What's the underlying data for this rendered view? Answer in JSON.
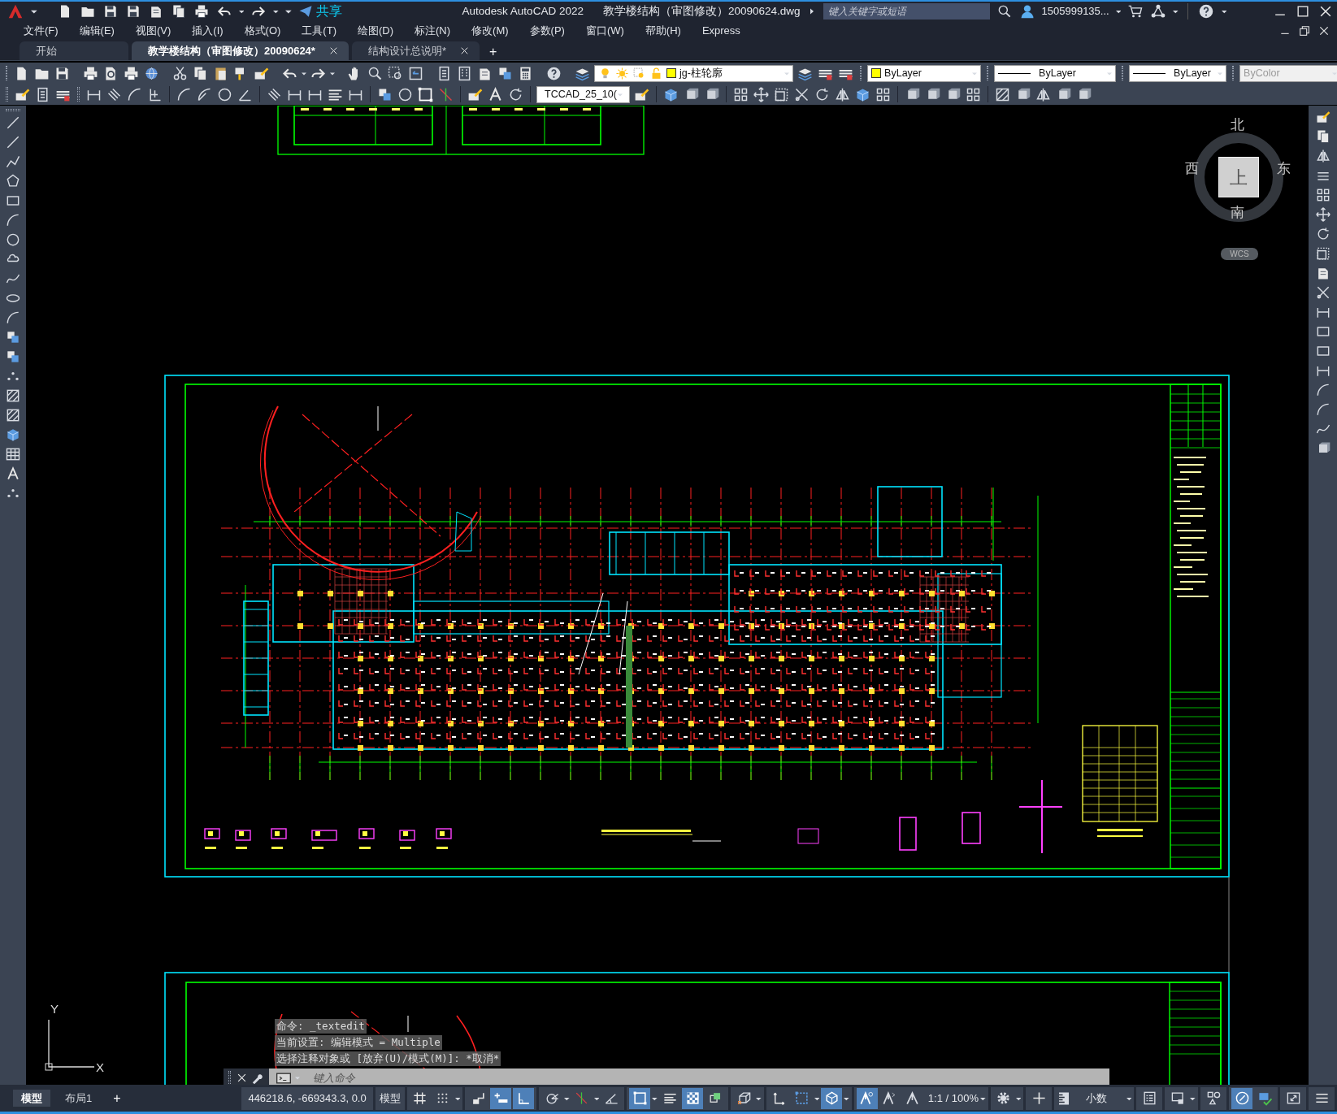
{
  "title_bar": {
    "app": "Autodesk AutoCAD 2022",
    "document": "教学楼结构（审图修改）20090624.dwg",
    "share": "共享",
    "search": {
      "placeholder": "键入关键字或短语"
    },
    "user": "1505999135..."
  },
  "menus": [
    "文件(F)",
    "编辑(E)",
    "视图(V)",
    "插入(I)",
    "格式(O)",
    "工具(T)",
    "绘图(D)",
    "标注(N)",
    "修改(M)",
    "参数(P)",
    "窗口(W)",
    "帮助(H)",
    "Express"
  ],
  "tabs": [
    {
      "label": "开始",
      "selected": false,
      "closable": false
    },
    {
      "label": "教学楼结构（审图修改）20090624*",
      "selected": true,
      "closable": true
    },
    {
      "label": "结构设计总说明*",
      "selected": false,
      "closable": true
    }
  ],
  "new_tab": "+",
  "properties": {
    "layer": {
      "name": "jg-柱轮廓",
      "color": "#ffff00"
    },
    "color": {
      "value": "ByLayer",
      "color": "#ffff00"
    },
    "linetype": "ByLayer",
    "lineweight": "ByLayer",
    "plot_style": {
      "value": "ByColor",
      "disabled": true
    }
  },
  "text_style": "TCCAD_25_10(",
  "viewcube": {
    "north": "北",
    "south": "南",
    "west": "西",
    "east": "东",
    "face": "上",
    "ucs": "WCS"
  },
  "ucs_icon": {
    "x": "X",
    "y": "Y"
  },
  "command_line": {
    "history": [
      "命令: _textedit",
      "当前设置: 编辑模式 = Multiple",
      "选择注释对象或 [放弃(U)/模式(M)]: *取消*"
    ],
    "placeholder": "键入命令"
  },
  "layout_tabs": [
    {
      "label": "模型",
      "selected": true
    },
    {
      "label": "布局1",
      "selected": false
    }
  ],
  "new_layout": "+",
  "status_bar": {
    "coordinates": "446218.6, -669343.3, 0.0",
    "space": "模型",
    "toggles": [
      {
        "on": false
      },
      {
        "on": false
      },
      {
        "on": false
      },
      {
        "on": true
      },
      {
        "on": true
      },
      {
        "on": false
      },
      {
        "on": false
      },
      {
        "on": false
      },
      {
        "on": true
      },
      {
        "on": false
      },
      {
        "on": true
      },
      {
        "on": false
      },
      {
        "on": false
      },
      {
        "on": false
      },
      {
        "on": false
      },
      {
        "on": true
      },
      {
        "on": true
      },
      {
        "on": false
      },
      {
        "on": false
      }
    ],
    "scale": "1:1 / 100%",
    "units": "小数",
    "tools": [
      {
        "on": false
      },
      {
        "on": false
      },
      {
        "on": false
      },
      {
        "on": false
      },
      {
        "on": false
      },
      {
        "on": true
      },
      {
        "on": false
      },
      {
        "on": false
      },
      {
        "on": false
      }
    ]
  }
}
